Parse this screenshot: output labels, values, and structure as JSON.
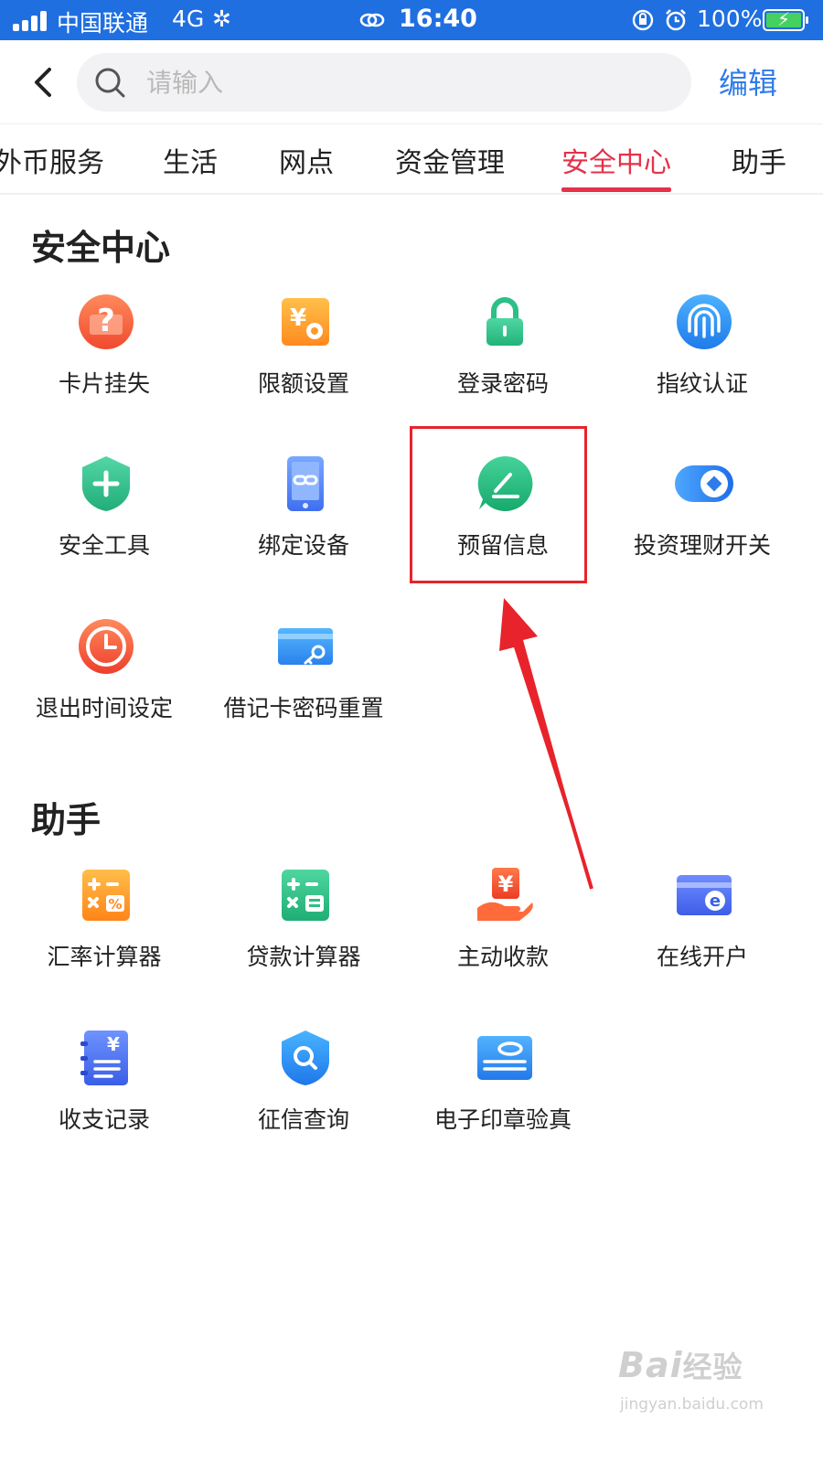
{
  "status_bar": {
    "carrier": "中国联通",
    "network": "4G",
    "time": "16:40",
    "battery": "100%",
    "battery_level": 1.0
  },
  "nav": {
    "search_placeholder": "请输入",
    "edit_label": "编辑"
  },
  "tabs": [
    {
      "label": "外币服务",
      "active": false
    },
    {
      "label": "生活",
      "active": false
    },
    {
      "label": "网点",
      "active": false
    },
    {
      "label": "资金管理",
      "active": false
    },
    {
      "label": "安全中心",
      "active": true
    },
    {
      "label": "助手",
      "active": false
    }
  ],
  "sections": {
    "security": {
      "title": "安全中心",
      "items": [
        {
          "label": "卡片挂失",
          "icon": "question-card-icon"
        },
        {
          "label": "限额设置",
          "icon": "yen-gear-icon"
        },
        {
          "label": "登录密码",
          "icon": "lock-icon"
        },
        {
          "label": "指纹认证",
          "icon": "fingerprint-icon"
        },
        {
          "label": "安全工具",
          "icon": "shield-plus-icon"
        },
        {
          "label": "绑定设备",
          "icon": "phone-link-icon"
        },
        {
          "label": "预留信息",
          "icon": "chat-edit-icon"
        },
        {
          "label": "投资理财开关",
          "icon": "toggle-switch-icon"
        },
        {
          "label": "退出时间设定",
          "icon": "clock-icon"
        },
        {
          "label": "借记卡密码重置",
          "icon": "card-key-icon"
        }
      ]
    },
    "assistant": {
      "title": "助手",
      "items": [
        {
          "label": "汇率计算器",
          "icon": "calculator-percent-icon"
        },
        {
          "label": "贷款计算器",
          "icon": "calculator-loan-icon"
        },
        {
          "label": "主动收款",
          "icon": "hand-yen-icon"
        },
        {
          "label": "在线开户",
          "icon": "card-e-icon"
        },
        {
          "label": "收支记录",
          "icon": "notebook-yen-icon"
        },
        {
          "label": "征信查询",
          "icon": "shield-search-icon"
        },
        {
          "label": "电子印章验真",
          "icon": "seal-stamp-icon"
        }
      ]
    }
  },
  "watermark": {
    "brand": "Bai",
    "brand_cn": "经验",
    "domain": "jingyan.baidu.com"
  },
  "colors": {
    "status_bar": "#1f6fe0",
    "accent": "#e5314a",
    "edit_link": "#2f7be8",
    "annotation": "#e8232b"
  }
}
